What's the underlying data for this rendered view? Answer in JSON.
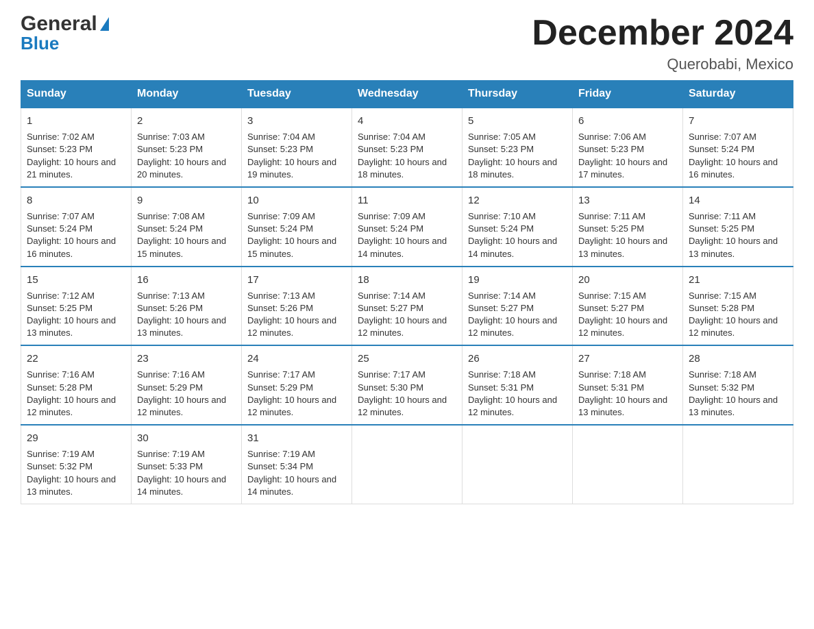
{
  "header": {
    "logo_line1": "General",
    "logo_line2": "Blue",
    "month_title": "December 2024",
    "location": "Querobabi, Mexico"
  },
  "days_of_week": [
    "Sunday",
    "Monday",
    "Tuesday",
    "Wednesday",
    "Thursday",
    "Friday",
    "Saturday"
  ],
  "weeks": [
    [
      {
        "day": "1",
        "sunrise": "7:02 AM",
        "sunset": "5:23 PM",
        "daylight": "10 hours and 21 minutes."
      },
      {
        "day": "2",
        "sunrise": "7:03 AM",
        "sunset": "5:23 PM",
        "daylight": "10 hours and 20 minutes."
      },
      {
        "day": "3",
        "sunrise": "7:04 AM",
        "sunset": "5:23 PM",
        "daylight": "10 hours and 19 minutes."
      },
      {
        "day": "4",
        "sunrise": "7:04 AM",
        "sunset": "5:23 PM",
        "daylight": "10 hours and 18 minutes."
      },
      {
        "day": "5",
        "sunrise": "7:05 AM",
        "sunset": "5:23 PM",
        "daylight": "10 hours and 18 minutes."
      },
      {
        "day": "6",
        "sunrise": "7:06 AM",
        "sunset": "5:23 PM",
        "daylight": "10 hours and 17 minutes."
      },
      {
        "day": "7",
        "sunrise": "7:07 AM",
        "sunset": "5:24 PM",
        "daylight": "10 hours and 16 minutes."
      }
    ],
    [
      {
        "day": "8",
        "sunrise": "7:07 AM",
        "sunset": "5:24 PM",
        "daylight": "10 hours and 16 minutes."
      },
      {
        "day": "9",
        "sunrise": "7:08 AM",
        "sunset": "5:24 PM",
        "daylight": "10 hours and 15 minutes."
      },
      {
        "day": "10",
        "sunrise": "7:09 AM",
        "sunset": "5:24 PM",
        "daylight": "10 hours and 15 minutes."
      },
      {
        "day": "11",
        "sunrise": "7:09 AM",
        "sunset": "5:24 PM",
        "daylight": "10 hours and 14 minutes."
      },
      {
        "day": "12",
        "sunrise": "7:10 AM",
        "sunset": "5:24 PM",
        "daylight": "10 hours and 14 minutes."
      },
      {
        "day": "13",
        "sunrise": "7:11 AM",
        "sunset": "5:25 PM",
        "daylight": "10 hours and 13 minutes."
      },
      {
        "day": "14",
        "sunrise": "7:11 AM",
        "sunset": "5:25 PM",
        "daylight": "10 hours and 13 minutes."
      }
    ],
    [
      {
        "day": "15",
        "sunrise": "7:12 AM",
        "sunset": "5:25 PM",
        "daylight": "10 hours and 13 minutes."
      },
      {
        "day": "16",
        "sunrise": "7:13 AM",
        "sunset": "5:26 PM",
        "daylight": "10 hours and 13 minutes."
      },
      {
        "day": "17",
        "sunrise": "7:13 AM",
        "sunset": "5:26 PM",
        "daylight": "10 hours and 12 minutes."
      },
      {
        "day": "18",
        "sunrise": "7:14 AM",
        "sunset": "5:27 PM",
        "daylight": "10 hours and 12 minutes."
      },
      {
        "day": "19",
        "sunrise": "7:14 AM",
        "sunset": "5:27 PM",
        "daylight": "10 hours and 12 minutes."
      },
      {
        "day": "20",
        "sunrise": "7:15 AM",
        "sunset": "5:27 PM",
        "daylight": "10 hours and 12 minutes."
      },
      {
        "day": "21",
        "sunrise": "7:15 AM",
        "sunset": "5:28 PM",
        "daylight": "10 hours and 12 minutes."
      }
    ],
    [
      {
        "day": "22",
        "sunrise": "7:16 AM",
        "sunset": "5:28 PM",
        "daylight": "10 hours and 12 minutes."
      },
      {
        "day": "23",
        "sunrise": "7:16 AM",
        "sunset": "5:29 PM",
        "daylight": "10 hours and 12 minutes."
      },
      {
        "day": "24",
        "sunrise": "7:17 AM",
        "sunset": "5:29 PM",
        "daylight": "10 hours and 12 minutes."
      },
      {
        "day": "25",
        "sunrise": "7:17 AM",
        "sunset": "5:30 PM",
        "daylight": "10 hours and 12 minutes."
      },
      {
        "day": "26",
        "sunrise": "7:18 AM",
        "sunset": "5:31 PM",
        "daylight": "10 hours and 12 minutes."
      },
      {
        "day": "27",
        "sunrise": "7:18 AM",
        "sunset": "5:31 PM",
        "daylight": "10 hours and 13 minutes."
      },
      {
        "day": "28",
        "sunrise": "7:18 AM",
        "sunset": "5:32 PM",
        "daylight": "10 hours and 13 minutes."
      }
    ],
    [
      {
        "day": "29",
        "sunrise": "7:19 AM",
        "sunset": "5:32 PM",
        "daylight": "10 hours and 13 minutes."
      },
      {
        "day": "30",
        "sunrise": "7:19 AM",
        "sunset": "5:33 PM",
        "daylight": "10 hours and 14 minutes."
      },
      {
        "day": "31",
        "sunrise": "7:19 AM",
        "sunset": "5:34 PM",
        "daylight": "10 hours and 14 minutes."
      },
      null,
      null,
      null,
      null
    ]
  ]
}
